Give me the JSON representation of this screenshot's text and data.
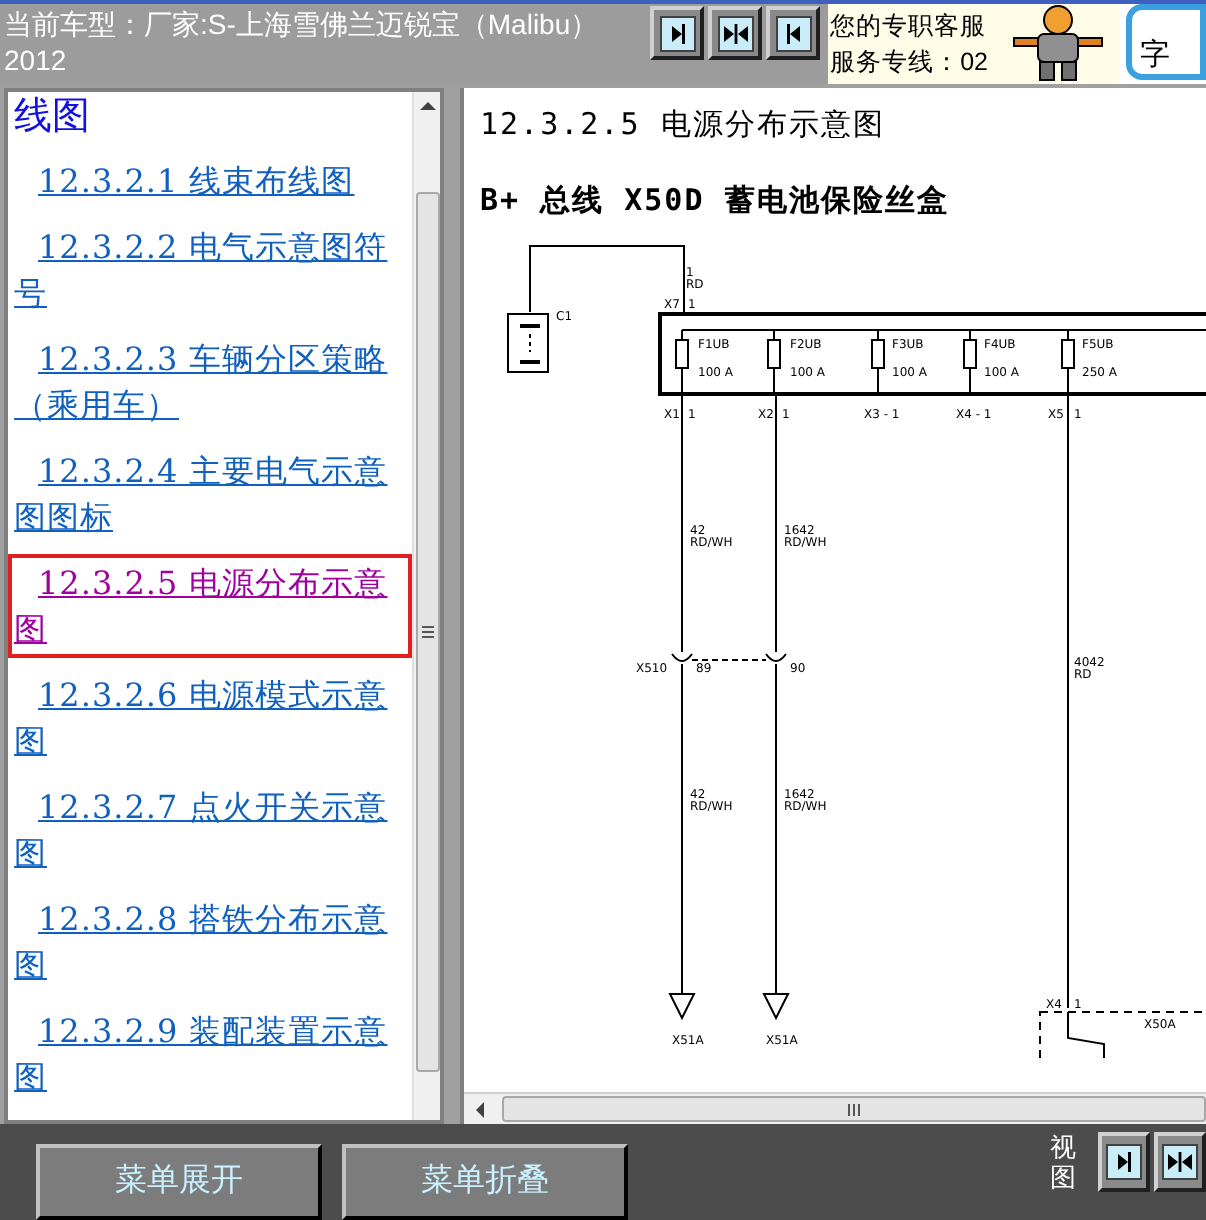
{
  "header": {
    "vehicle": "当前车型：厂家:S-上海雪佛兰迈锐宝（Malibu）2012",
    "service_line_1": "您的专职客服",
    "service_line_2": "服务专线：02",
    "keyword_fragment": "字"
  },
  "sidebar": {
    "heading_fragment": "线图",
    "items": [
      {
        "label": "12.3.2.1 线束布线图",
        "selected": false
      },
      {
        "label": "12.3.2.2 电气示意图符号",
        "selected": false
      },
      {
        "label": "12.3.2.3 车辆分区策略（乘用车）",
        "selected": false
      },
      {
        "label": "12.3.2.4 主要电气示意图图标",
        "selected": false
      },
      {
        "label": "12.3.2.5 电源分布示意图",
        "selected": true
      },
      {
        "label": "12.3.2.6 电源模式示意图",
        "selected": false
      },
      {
        "label": "12.3.2.7 点火开关示意图",
        "selected": false
      },
      {
        "label": "12.3.2.8 搭铁分布示意图",
        "selected": false
      },
      {
        "label": "12.3.2.9 装配装置示意图",
        "selected": false
      }
    ]
  },
  "content": {
    "title": "12.3.2.5 电源分布示意图",
    "subtitle": "B+ 总线 X50D 蓄电池保险丝盒",
    "diagram_labels": [
      "1",
      "RD",
      "C1",
      "X7",
      "1",
      "F1UB",
      "100 A",
      "F2UB",
      "100 A",
      "F3UB",
      "100 A",
      "F4UB",
      "100 A",
      "F5UB",
      "250 A",
      "X1",
      "1",
      "X2",
      "1",
      "X3 - 1",
      "X4 - 1",
      "X5",
      "1",
      "42",
      "RD/WH",
      "1642",
      "RD/WH",
      "X510",
      "89",
      "90",
      "4042",
      "RD",
      "42",
      "RD/WH",
      "1642",
      "RD/WH",
      "X51A",
      "X51A",
      "X4",
      "1",
      "X50A"
    ]
  },
  "footer": {
    "buttons": [
      "菜单展开",
      "菜单折叠"
    ],
    "view_label": "视图"
  }
}
